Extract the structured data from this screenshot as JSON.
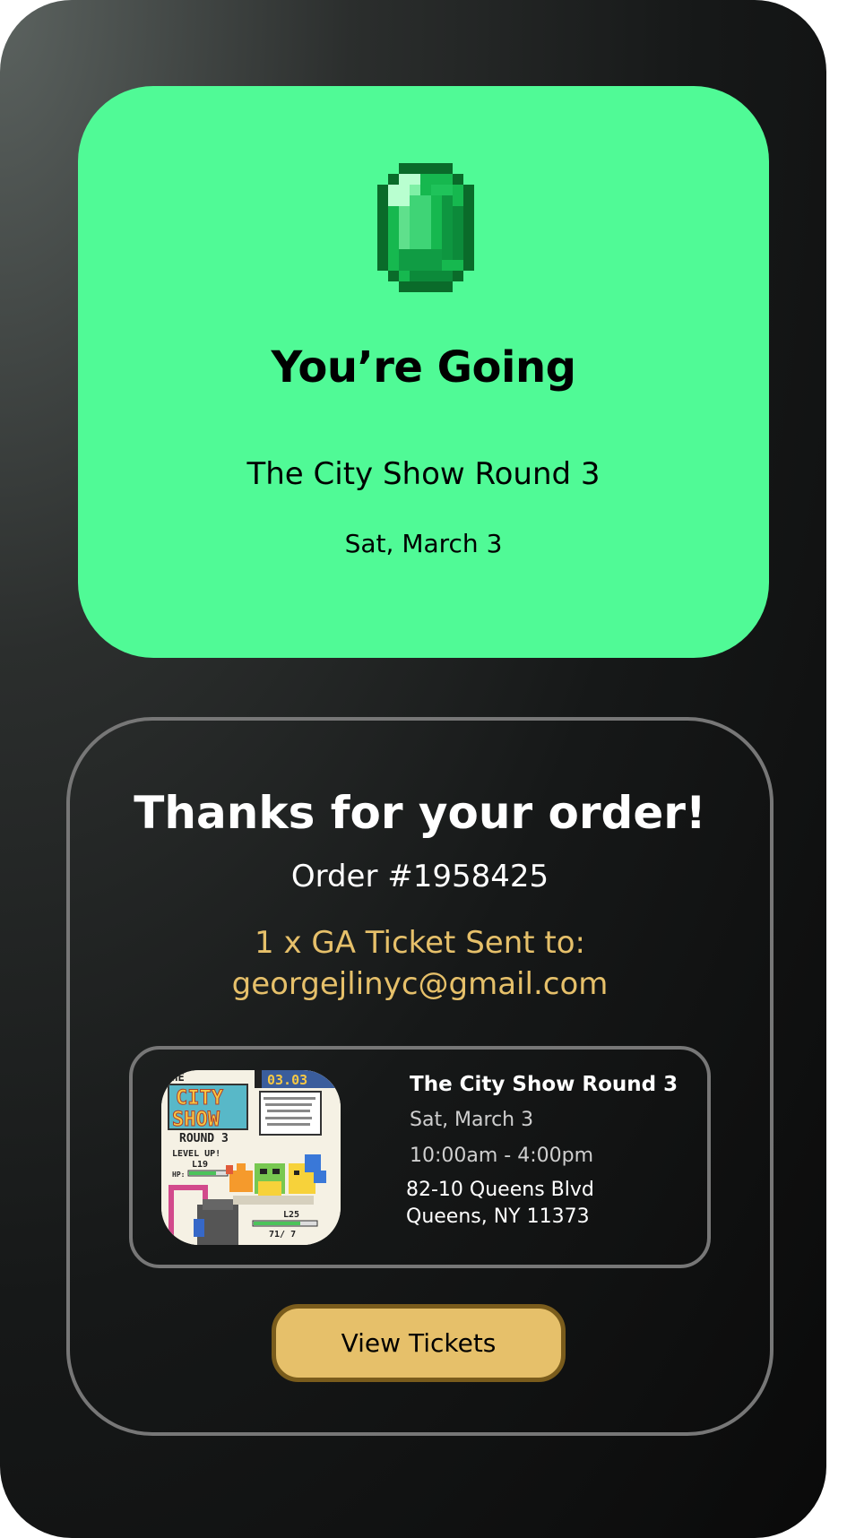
{
  "hero": {
    "title": "You’re Going",
    "event_name": "The City Show Round 3",
    "date": "Sat, March 3",
    "icon": "emerald-gem-icon",
    "color": "#50fa96"
  },
  "order": {
    "thanks": "Thanks for your order!",
    "order_number": "Order #1958425",
    "sent_line": "1 x GA Ticket Sent to:",
    "email": "georgejlinyc@gmail.com",
    "accent_color": "#e6c06a"
  },
  "event_card": {
    "title": "The City Show Round 3",
    "date": "Sat, March 3",
    "time": "10:00am - 4:00pm",
    "address_line1": "82-10 Queens Blvd",
    "address_line2": "Queens, NY 11373"
  },
  "poster": {
    "line1": "THE",
    "line2": "CITY",
    "line3": "SHOW",
    "line4": "ROUND 3",
    "date": "03.03",
    "level": "LEVEL UP!",
    "level_value": "L19",
    "hp_left": "HP:",
    "hp_value": "L25",
    "hp_count": "71/ 7"
  },
  "actions": {
    "view_tickets": "View Tickets"
  }
}
